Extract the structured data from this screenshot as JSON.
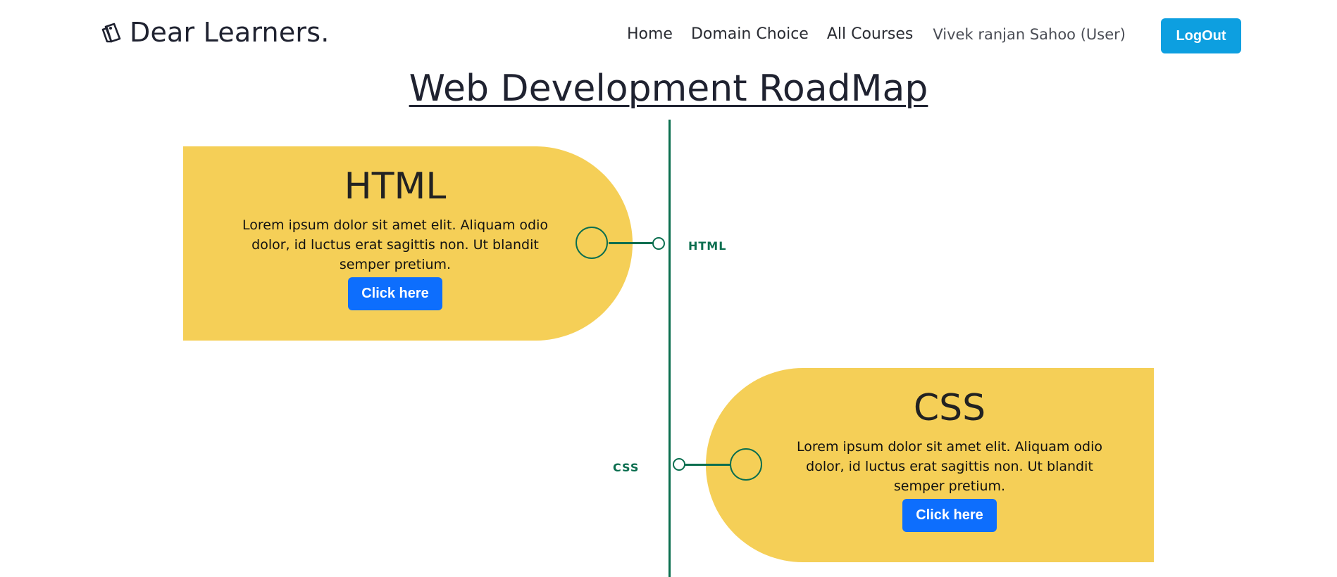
{
  "brand": {
    "name": "Dear Learners.",
    "icon": "tag-icon"
  },
  "nav": {
    "links": [
      "Home",
      "Domain Choice",
      "All Courses"
    ],
    "user": "Vivek ranjan Sahoo (User)",
    "logout_label": "LogOut"
  },
  "page": {
    "title": "Web Development RoadMap"
  },
  "roadmap": {
    "steps": [
      {
        "title": "HTML",
        "text": "Lorem ipsum dolor sit amet elit. Aliquam odio dolor, id luctus erat sagittis non. Ut blandit semper pretium.",
        "button_label": "Click here",
        "timeline_label": "HTML"
      },
      {
        "title": "CSS",
        "text": "Lorem ipsum dolor sit amet elit. Aliquam odio dolor, id luctus erat sagittis non. Ut blandit semper pretium.",
        "button_label": "Click here",
        "timeline_label": "CSS"
      }
    ]
  },
  "colors": {
    "card_background": "#f5cf57",
    "timeline": "#0b6e4f",
    "primary_button": "#0d6efd",
    "logout_button": "#0d9fe0"
  }
}
